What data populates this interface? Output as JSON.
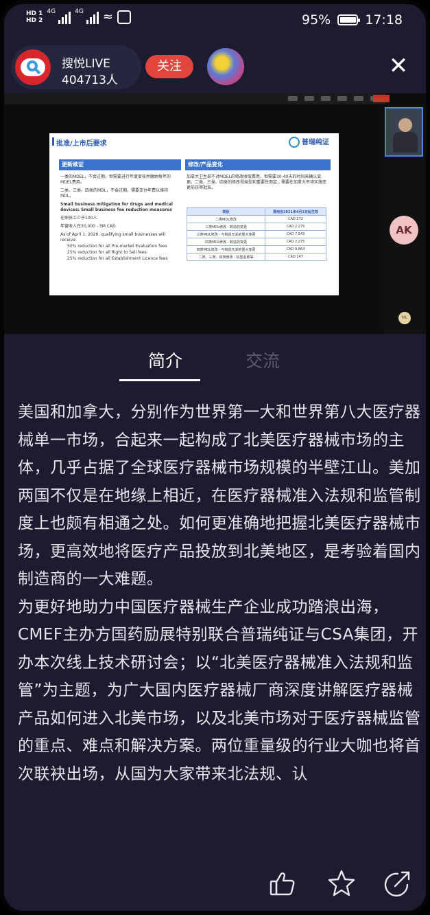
{
  "status_bar": {
    "hd1": "HD 1",
    "hd2": "HD 2",
    "net1": "4G",
    "net2": "4G",
    "battery": "95%",
    "time": "17:18"
  },
  "host": {
    "name": "搜悦LIVE",
    "viewers": "404713人",
    "follow_label": "关注"
  },
  "slide": {
    "title": "批准/上市后要求",
    "logo": "普瑞纯证",
    "left_heading": "更新续证",
    "left_points": [
      "一类的MDEL，不会过期，但需要进行年度审核并缴纳每年的MDEL费用。",
      "二类、三类、四类的MDL，不会过期，需要支付年费以维持MDL。",
      "Small business mitigation for drugs and medical devices: Small business fee reduction measures",
      "在职员工少于100人",
      "年营收入在30,000 - 5M CAD",
      "As of April 1, 2020, qualifying small businesses will receive:",
      "50% reduction for all Pre-market Evaluation fees",
      "25% reduction for all Right to Sell fees",
      "25% reduction for all Establishment Licence fees"
    ],
    "right_heading": "修改/产品变化",
    "right_text": "加拿大卫生部不对MDEL的修改收取费用，但需要30-40天的时间来确认变更。二类、三类、四类的修改视类型和重要性而定，需要在加拿大市场实施变更前获得批准。",
    "fee_table": {
      "headers": [
        "类别",
        "费用自2021年4月1日起生效"
      ],
      "rows": [
        [
          "二类MDL修改",
          "CAD 272"
        ],
        [
          "三类MDL修改 - 制造的变更",
          "CAD 2,275"
        ],
        [
          "三类MDL修改 - 与制造无关的重大变更",
          "CAD 7,543"
        ],
        [
          "四类MDL修改 - 制造的变更",
          "CAD 2,275"
        ],
        [
          "四类MDL修改 - 与制造无关的重大变更",
          "CAD 9,864"
        ],
        [
          "二类、三类、四类修改 - 标签名称等",
          "CAD 147"
        ]
      ]
    }
  },
  "participant": {
    "initials": "AK",
    "small_badge": "ML"
  },
  "tabs": {
    "intro": "简介",
    "chat": "交流"
  },
  "description": [
    "美国和加拿大，分别作为世界第一大和世界第八大医疗器械单一市场，合起来一起构成了北美医疗器械市场的主体，几乎占据了全球医疗器械市场规模的半壁江山。美加两国不仅是在地缘上相近，在医疗器械准入法规和监管制度上也颇有相通之处。如何更准确地把握北美医疗器械市场，更高效地将医疗产品投放到北美地区，是考验着国内制造商的一大难题。",
    "为更好地助力中国医疗器械生产企业成功踏浪出海，CMEF主办方国药励展特别联合普瑞纯证与CSA集团，开办本次线上技术研讨会；以“北美医疗器械准入法规和监管”为主题，为广大国内医疗器械厂商深度讲解医疗器械产品如何进入北美市场，以及北美市场对于医疗器械监管的重点、难点和解决方案。两位重量级的行业大咖也将首次联袂出场，从国为大家带来北法规、认"
  ],
  "icons": {
    "close": "close-icon",
    "like": "thumbs-up-icon",
    "favorite": "star-icon",
    "share": "share-icon"
  }
}
